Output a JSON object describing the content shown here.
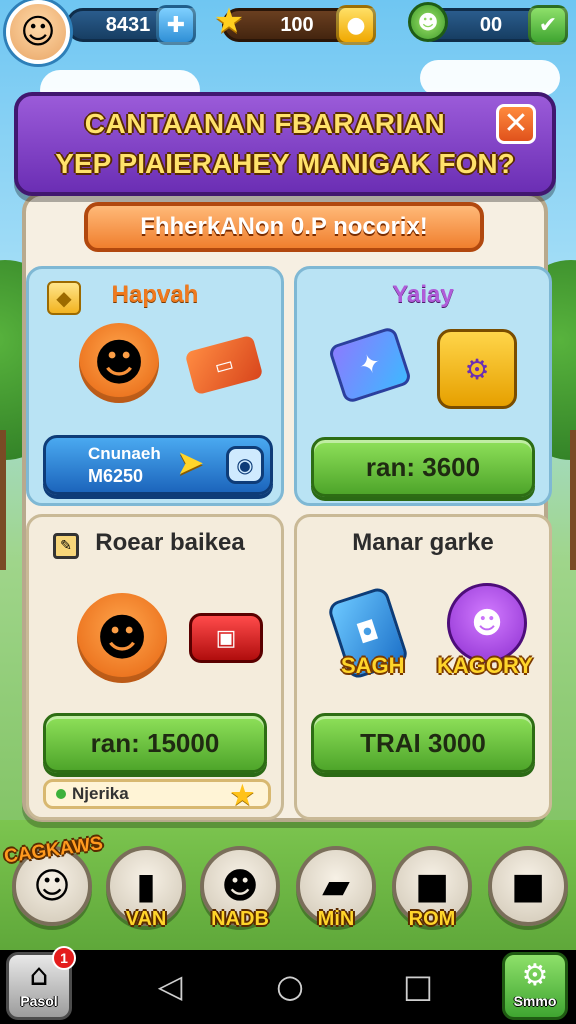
{
  "hud": {
    "gems_value": "8431",
    "stars_value": "100",
    "green_value": "00"
  },
  "banner": {
    "title_line1": "CANTAANAN FBARARIAN",
    "title_line2": "YEP PIAIERAHEY MANIGAK FON?",
    "subtitle": "FhherkANon 0.P nocorix!"
  },
  "cards": [
    {
      "title": "Hapvah",
      "button_line1": "Cnunaeh",
      "button_line2": "M6250"
    },
    {
      "title": "Yaiay",
      "button": "ran: 3600"
    },
    {
      "title": "Roear baikea",
      "button": "ran: 15000",
      "status": "Njerika"
    },
    {
      "title": "Manar garke",
      "item1_label": "SAGH",
      "item2_label": "KAGORY",
      "button": "TRAI 3000"
    }
  ],
  "categories": {
    "badge": "CAGKAWS",
    "items": [
      {
        "label": "VAN"
      },
      {
        "label": "NADB"
      },
      {
        "label": "MiN"
      },
      {
        "label": "ROM"
      }
    ]
  },
  "bottom_bar": {
    "left_label": "Pasol",
    "left_badge": "1",
    "right_label": "Smmo"
  },
  "colors": {
    "banner_purple": "#7b3dc4",
    "buy_green": "#5db534",
    "accent_yellow": "#ffd52a",
    "subtitle_orange": "#f07f2e"
  }
}
